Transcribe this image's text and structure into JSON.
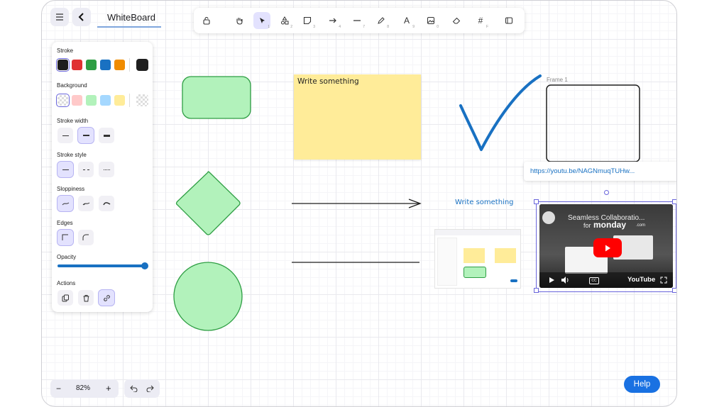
{
  "header": {
    "menu_icon": "hamburger-icon",
    "back_icon": "chevron-left-icon",
    "title": "WhiteBoard"
  },
  "toolbar": {
    "tools": [
      {
        "name": "lock",
        "icon": "lock-icon",
        "shortcut": ""
      },
      {
        "name": "hand",
        "icon": "hand-icon",
        "shortcut": ""
      },
      {
        "name": "selection",
        "icon": "cursor-icon",
        "shortcut": "1"
      },
      {
        "name": "shapes",
        "icon": "shapes-icon",
        "shortcut": "2"
      },
      {
        "name": "sticky-note",
        "icon": "sticky-note-icon",
        "shortcut": "3"
      },
      {
        "name": "arrow",
        "icon": "arrow-icon",
        "shortcut": "4"
      },
      {
        "name": "line",
        "icon": "line-icon",
        "shortcut": "7"
      },
      {
        "name": "draw",
        "icon": "pencil-icon",
        "shortcut": "8"
      },
      {
        "name": "text",
        "icon": "text-icon",
        "shortcut": "9"
      },
      {
        "name": "image",
        "icon": "image-icon",
        "shortcut": "0"
      },
      {
        "name": "eraser",
        "icon": "eraser-icon",
        "shortcut": ""
      },
      {
        "name": "frame",
        "icon": "frame-icon",
        "shortcut": "F"
      },
      {
        "name": "library",
        "icon": "library-icon",
        "shortcut": ""
      }
    ],
    "active": "selection"
  },
  "properties": {
    "stroke_label": "Stroke",
    "stroke_colors": [
      "#1e1e1e",
      "#e03131",
      "#2f9e44",
      "#1971c2",
      "#f08c00"
    ],
    "stroke_current": "#1e1e1e",
    "background_label": "Background",
    "background_colors": [
      "transparent",
      "#ffc9c9",
      "#b2f2bb",
      "#a5d8ff",
      "#ffec99"
    ],
    "stroke_width_label": "Stroke width",
    "stroke_style_label": "Stroke style",
    "sloppiness_label": "Sloppiness",
    "edges_label": "Edges",
    "opacity_label": "Opacity",
    "opacity_value": 100,
    "actions_label": "Actions",
    "actions": [
      "duplicate-icon",
      "trash-icon",
      "link-icon"
    ]
  },
  "canvas": {
    "sticky_text": "Write something",
    "free_text": "Write something",
    "frame_label": "Frame 1",
    "link_url": "https://youtu.be/NAGNmuqTUHw...",
    "video": {
      "title": "Seamless Collaboratio...",
      "brand": "monday",
      "brand_suffix": ".com",
      "brand_prefix": "for",
      "platform": "YouTube"
    },
    "colors": {
      "shape_fill": "#b2f2bb",
      "shape_stroke": "#2f9e44",
      "sticky": "#ffec99",
      "check": "#1971c2",
      "selection": "#6965db"
    }
  },
  "footer": {
    "zoom_out": "−",
    "zoom": "82%",
    "zoom_in": "+",
    "undo_icon": "undo-icon",
    "redo_icon": "redo-icon",
    "help": "Help"
  }
}
